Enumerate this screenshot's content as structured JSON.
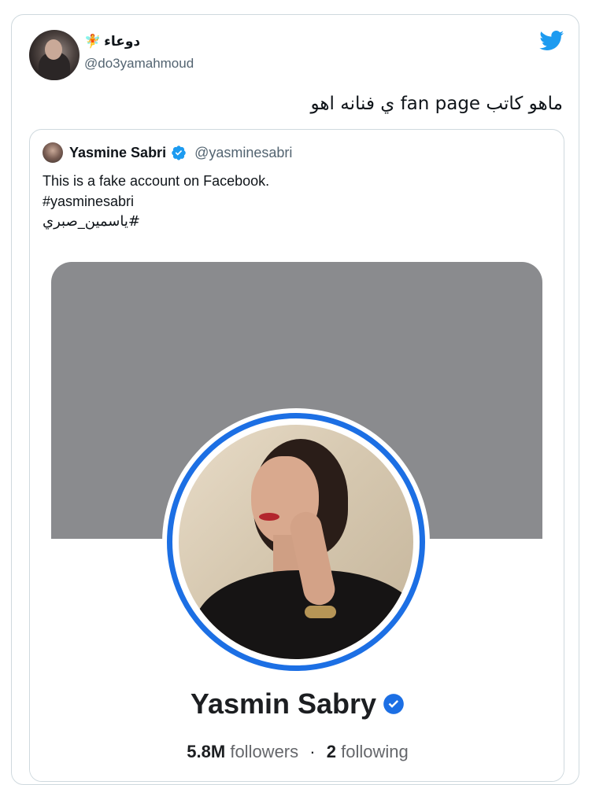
{
  "tweet": {
    "author_name": "دوعاء",
    "author_emoji": "🧚",
    "author_handle": "@do3yamahmoud",
    "text": "ماهو كاتب fan page ي فنانه اهو"
  },
  "quote": {
    "author_name": "Yasmine Sabri",
    "author_handle": "@yasminesabri",
    "lines": [
      "This is a fake account on Facebook.",
      "#yasminesabri",
      "#ياسمين_صبري"
    ]
  },
  "facebook_screenshot": {
    "profile_name": "Yasmin Sabry",
    "followers_count": "5.8M",
    "followers_label": "followers",
    "separator": "·",
    "following_count": "2",
    "following_label": "following"
  },
  "colors": {
    "twitter_blue": "#1d9bf0",
    "facebook_blue": "#1c6fe4",
    "cover_gray": "#8a8b8e"
  },
  "icons": {
    "brand": "twitter-bird-icon",
    "verified": "verified-badge-icon"
  }
}
